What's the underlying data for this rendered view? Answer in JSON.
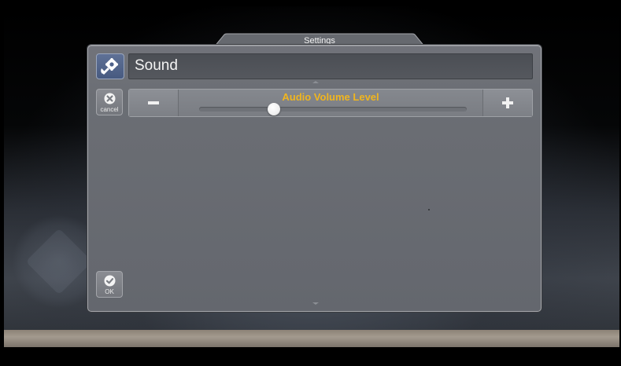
{
  "window": {
    "tab_title": "Settings"
  },
  "header": {
    "title": "Sound",
    "icon": "wrench-gear-icon"
  },
  "buttons": {
    "cancel_label": "cancel",
    "ok_label": "OK"
  },
  "volume": {
    "label": "Audio Volume Level",
    "decrease": "−",
    "increase": "+",
    "level": 0.28
  },
  "colors": {
    "accent_label": "#f0b51e",
    "header_icon_bg": "#475a80"
  }
}
